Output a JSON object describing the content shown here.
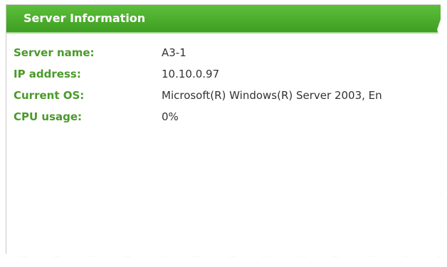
{
  "panel": {
    "title": "Server Information"
  },
  "server_info": [
    {
      "label": "Server name:",
      "value": "A3-1"
    },
    {
      "label": "IP address:",
      "value": "10.10.0.97"
    },
    {
      "label": "Current OS:",
      "value": "Microsoft(R) Windows(R) Server 2003, En"
    },
    {
      "label": "CPU usage:",
      "value": "0%"
    }
  ],
  "colors": {
    "header_green": "#4aaa2c",
    "label_green": "#4a9a2a",
    "value_text": "#333333"
  }
}
